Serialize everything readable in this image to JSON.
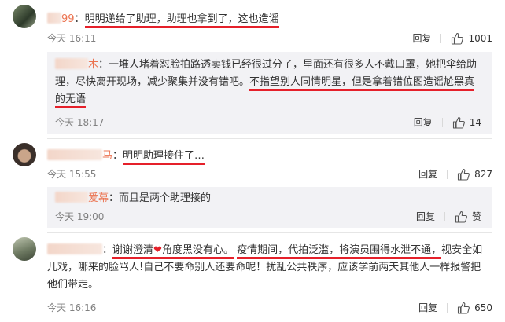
{
  "comments": [
    {
      "name": "99",
      "sep": "：",
      "text": "明明递给了助理，助理也拿到了，这也造谣",
      "time": "今天 16:11",
      "reply": "回复",
      "likes": "1001",
      "reply_item": {
        "name": "木",
        "sep": "：",
        "text_a": "一堆人堵着怼脸拍路透卖钱已经很过分了，里面还有很多人不戴口罩，她把伞给助理，尽快离开现场，减少聚集并没有错吧。",
        "text_b": "不指望别人同情明星，但是拿着错位图造谣尬黑真的无语",
        "time": "今天 18:17",
        "reply": "回复",
        "likes": "14"
      }
    },
    {
      "name": "马",
      "sep": "：",
      "text": "明明助理接住了…",
      "time": "今天 15:55",
      "reply": "回复",
      "likes": "827",
      "reply_item": {
        "name": "爱幕",
        "sep": "：",
        "text": "而且是两个助理接的",
        "time": "今天 19:00",
        "reply": "回复",
        "likes": "赞"
      }
    },
    {
      "name": "",
      "sep": "：",
      "text_a": "谢谢澄清",
      "heart": "❤",
      "text_b": "角度黑没有心。",
      "text_c": "疫情期间，代拍泛滥，将演员围得水泄不通，",
      "text_d": "视安全如儿戏，哪来的脸骂人!自己不要命别人还要命呢！扰乱公共秩序，应该学前两天其他人一样报警把他们带走。",
      "time": "今天 16:16",
      "reply": "回复",
      "likes": "650"
    }
  ],
  "colors": {
    "accent": "#eb7350",
    "underline": "#e5202a",
    "reply_bg": "#f2f2f5"
  }
}
